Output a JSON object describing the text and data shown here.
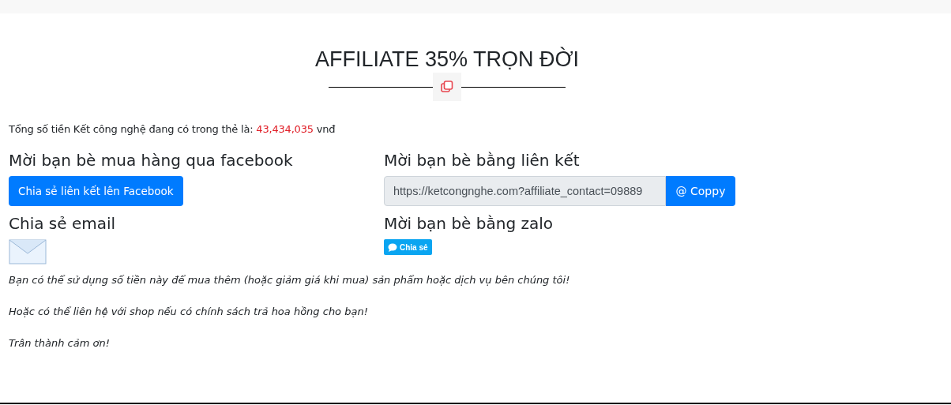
{
  "title": "AFFILIATE 35% TRỌN ĐỜI",
  "balance": {
    "prefix": "Tổng số tiền Kết công nghệ đang có trong thẻ là:",
    "amount": "43,434,035",
    "suffix": "vnđ"
  },
  "facebook": {
    "heading": "Mời bạn bè mua hàng qua facebook",
    "button": "Chia sẻ liên kết lên Facebook"
  },
  "link": {
    "heading": "Mời bạn bè bằng liên kết",
    "value": "https://ketcongnghe.com?affiliate_contact=09889",
    "button": "@ Coppy"
  },
  "email": {
    "heading": "Chia sẻ email"
  },
  "zalo": {
    "heading": "Mời bạn bè bằng zalo",
    "button": "Chia sẻ"
  },
  "notes": [
    "Bạn có thể sử dụng số tiền này để mua thêm (hoặc giảm giá khi mua) sản phẩm hoặc dịch vụ bên chúng tôi!",
    "Hoặc có thể liên hệ với shop nếu có chính sách trả hoa hồng cho bạn!",
    "Trân thành cảm ơn!"
  ]
}
